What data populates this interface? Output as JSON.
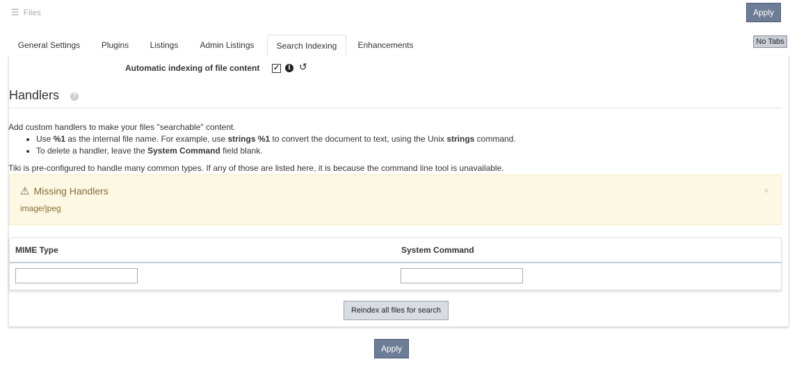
{
  "header": {
    "title": "Files",
    "title_icon": "list-icon",
    "apply_label": "Apply",
    "no_tabs_label": "No Tabs"
  },
  "tabs": [
    {
      "label": "General Settings"
    },
    {
      "label": "Plugins"
    },
    {
      "label": "Listings"
    },
    {
      "label": "Admin Listings"
    },
    {
      "label": "Search Indexing",
      "active": true
    },
    {
      "label": "Enhancements"
    }
  ],
  "indexing": {
    "label": "Automatic indexing of file content",
    "checked": true,
    "checkbox_mark": "✓"
  },
  "handlers": {
    "title": "Handlers",
    "intro": "Add custom handlers to make your files \"searchable\" content.",
    "bullet1_a": "Use ",
    "bullet1_b": "%1",
    "bullet1_c": " as the internal file name. For example, use ",
    "bullet1_d": "strings %1",
    "bullet1_e": " to convert the document to text, using the Unix ",
    "bullet1_f": "strings",
    "bullet1_g": " command.",
    "bullet2_a": "To delete a handler, leave the ",
    "bullet2_b": "System Command",
    "bullet2_c": " field blank.",
    "preconfigured": "Tiki is pre-configured to handle many common types. If any of those are listed here, it is because the command line tool is unavailable."
  },
  "alert": {
    "title": "Missing Handlers",
    "items": [
      "image/jpeg"
    ],
    "close": "×",
    "warning_glyph": "⚠"
  },
  "table": {
    "headers": [
      "MIME Type",
      "System Command"
    ],
    "row": {
      "mime_value": "",
      "command_value": ""
    }
  },
  "reindex_label": "Reindex all files for search",
  "footer": {
    "apply_label": "Apply"
  },
  "colors": {
    "apply_bg": "#6e7d97",
    "alert_bg": "#fcf8e3",
    "alert_text": "#8a6d3b"
  }
}
